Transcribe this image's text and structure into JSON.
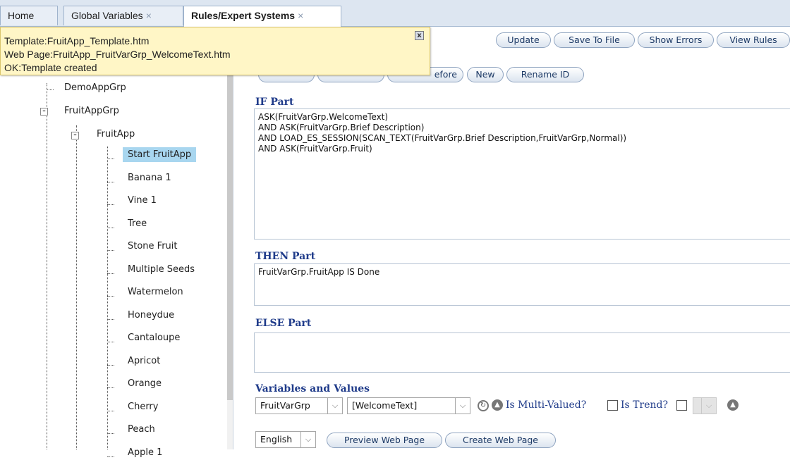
{
  "tabs": [
    {
      "label": "Home"
    },
    {
      "label": "Global Variables",
      "close": "×"
    },
    {
      "label": "Rules/Expert Systems",
      "close": "×"
    }
  ],
  "notification": {
    "lines": [
      "Template:FruitApp_Template.htm",
      "Web Page:FruitApp_FruitVarGrp_WelcomeText.htm",
      "OK:Template created"
    ],
    "close": "x"
  },
  "toolbar": {
    "update": "Update",
    "save": "Save To File",
    "errors": "Show Errors",
    "view": "View Rules",
    "before_partial": "efore",
    "new": "New",
    "rename": "Rename ID"
  },
  "tree": {
    "groups": [
      {
        "label": "DemoAppGrp"
      },
      {
        "label": "FruitAppGrp"
      }
    ],
    "app": "FruitApp",
    "items": [
      {
        "label": "Start FruitApp",
        "selected": true
      },
      {
        "label": "Banana 1"
      },
      {
        "label": "Vine 1"
      },
      {
        "label": "Tree"
      },
      {
        "label": "Stone Fruit"
      },
      {
        "label": "Multiple Seeds"
      },
      {
        "label": "Watermelon"
      },
      {
        "label": "Honeydue"
      },
      {
        "label": "Cantaloupe"
      },
      {
        "label": "Apricot"
      },
      {
        "label": "Orange"
      },
      {
        "label": "Cherry"
      },
      {
        "label": "Peach"
      },
      {
        "label": "Apple 1"
      }
    ]
  },
  "editor": {
    "if_label": "IF Part",
    "if_text": "ASK(FruitVarGrp.WelcomeText)\nAND ASK(FruitVarGrp.Brief Description)\nAND LOAD_ES_SESSION(SCAN_TEXT(FruitVarGrp.Brief Description,FruitVarGrp,Normal))\nAND ASK(FruitVarGrp.Fruit)",
    "then_label": "THEN Part",
    "then_text": "FruitVarGrp.FruitApp IS Done",
    "else_label": "ELSE Part",
    "else_text": ""
  },
  "variables": {
    "label": "Variables and Values",
    "group": "FruitVarGrp",
    "variable": "[WelcomeText]",
    "multi_label": "Is Multi-Valued?",
    "trend_label": "Is Trend?",
    "multi_checked": false,
    "trend_checked": false
  },
  "bottom": {
    "language": "English",
    "preview": "Preview Web Page",
    "create": "Create Web Page"
  },
  "icons": [
    "refresh-icon",
    "up-arrow-icon",
    "chevron-down-icon",
    "close-icon"
  ]
}
